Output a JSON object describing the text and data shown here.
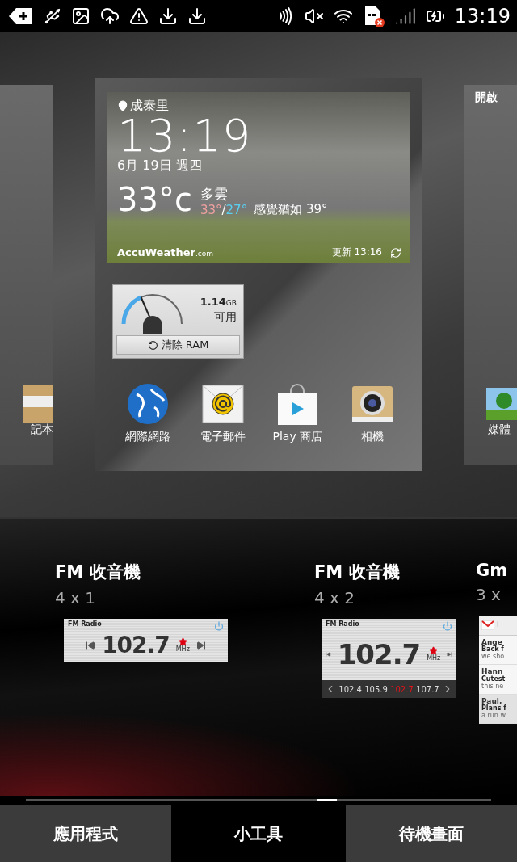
{
  "status_bar": {
    "time": "13:19"
  },
  "home_preview": {
    "left_panel": {
      "app_label": "記本"
    },
    "center_panel": {
      "weather": {
        "location": "成泰里",
        "time": "13:19",
        "date": "6月 19日 週四",
        "temperature": "33°c",
        "condition": "多雲",
        "high": "33°",
        "separator": "/",
        "low": "27°",
        "feels_like": "感覺猶如 39°",
        "brand": "AccuWeather",
        "brand_suffix": ".com",
        "updated": "更新 13:16"
      },
      "memory": {
        "amount": "1.14",
        "unit": "GB",
        "caption": "可用",
        "button": "清除 RAM",
        "level": 0.3
      },
      "apps": [
        {
          "kind": "globe",
          "label": "網際網路"
        },
        {
          "kind": "mail",
          "label": "電子郵件"
        },
        {
          "kind": "store",
          "label": "Play 商店"
        },
        {
          "kind": "camera",
          "label": "相機"
        }
      ]
    },
    "right_panel": {
      "widget_title": "開啟",
      "app_label": "媒體"
    }
  },
  "widgets": [
    {
      "kind": "radio_small",
      "title": "FM 收音機",
      "size": "4 x 1",
      "preview": {
        "name": "FM Radio",
        "frequency": "102.7",
        "unit": "MHz"
      }
    },
    {
      "kind": "radio_large",
      "title": "FM 收音機",
      "size": "4 x 2",
      "preview": {
        "name": "FM Radio",
        "frequency": "102.7",
        "unit": "MHz",
        "presets": [
          {
            "label": "102.4",
            "selected": false
          },
          {
            "label": "105.9",
            "selected": false
          },
          {
            "label": "102.7",
            "selected": true
          },
          {
            "label": "107.7",
            "selected": false
          }
        ]
      }
    },
    {
      "kind": "gmail",
      "title": "Gm",
      "size": "3 x",
      "preview": {
        "header": "I",
        "messages": [
          {
            "sender": "Ange",
            "subject": "Back f",
            "snippet": "we sho",
            "read": false
          },
          {
            "sender": "Hann",
            "subject": "Cutest",
            "snippet": "this ne",
            "read": false
          },
          {
            "sender": "Paul,",
            "subject": "Plans f",
            "snippet": "a run w",
            "read": true
          }
        ]
      }
    }
  ],
  "tabs": [
    {
      "label": "應用程式",
      "selected": false
    },
    {
      "label": "小工具",
      "selected": true
    },
    {
      "label": "待機畫面",
      "selected": false
    }
  ]
}
